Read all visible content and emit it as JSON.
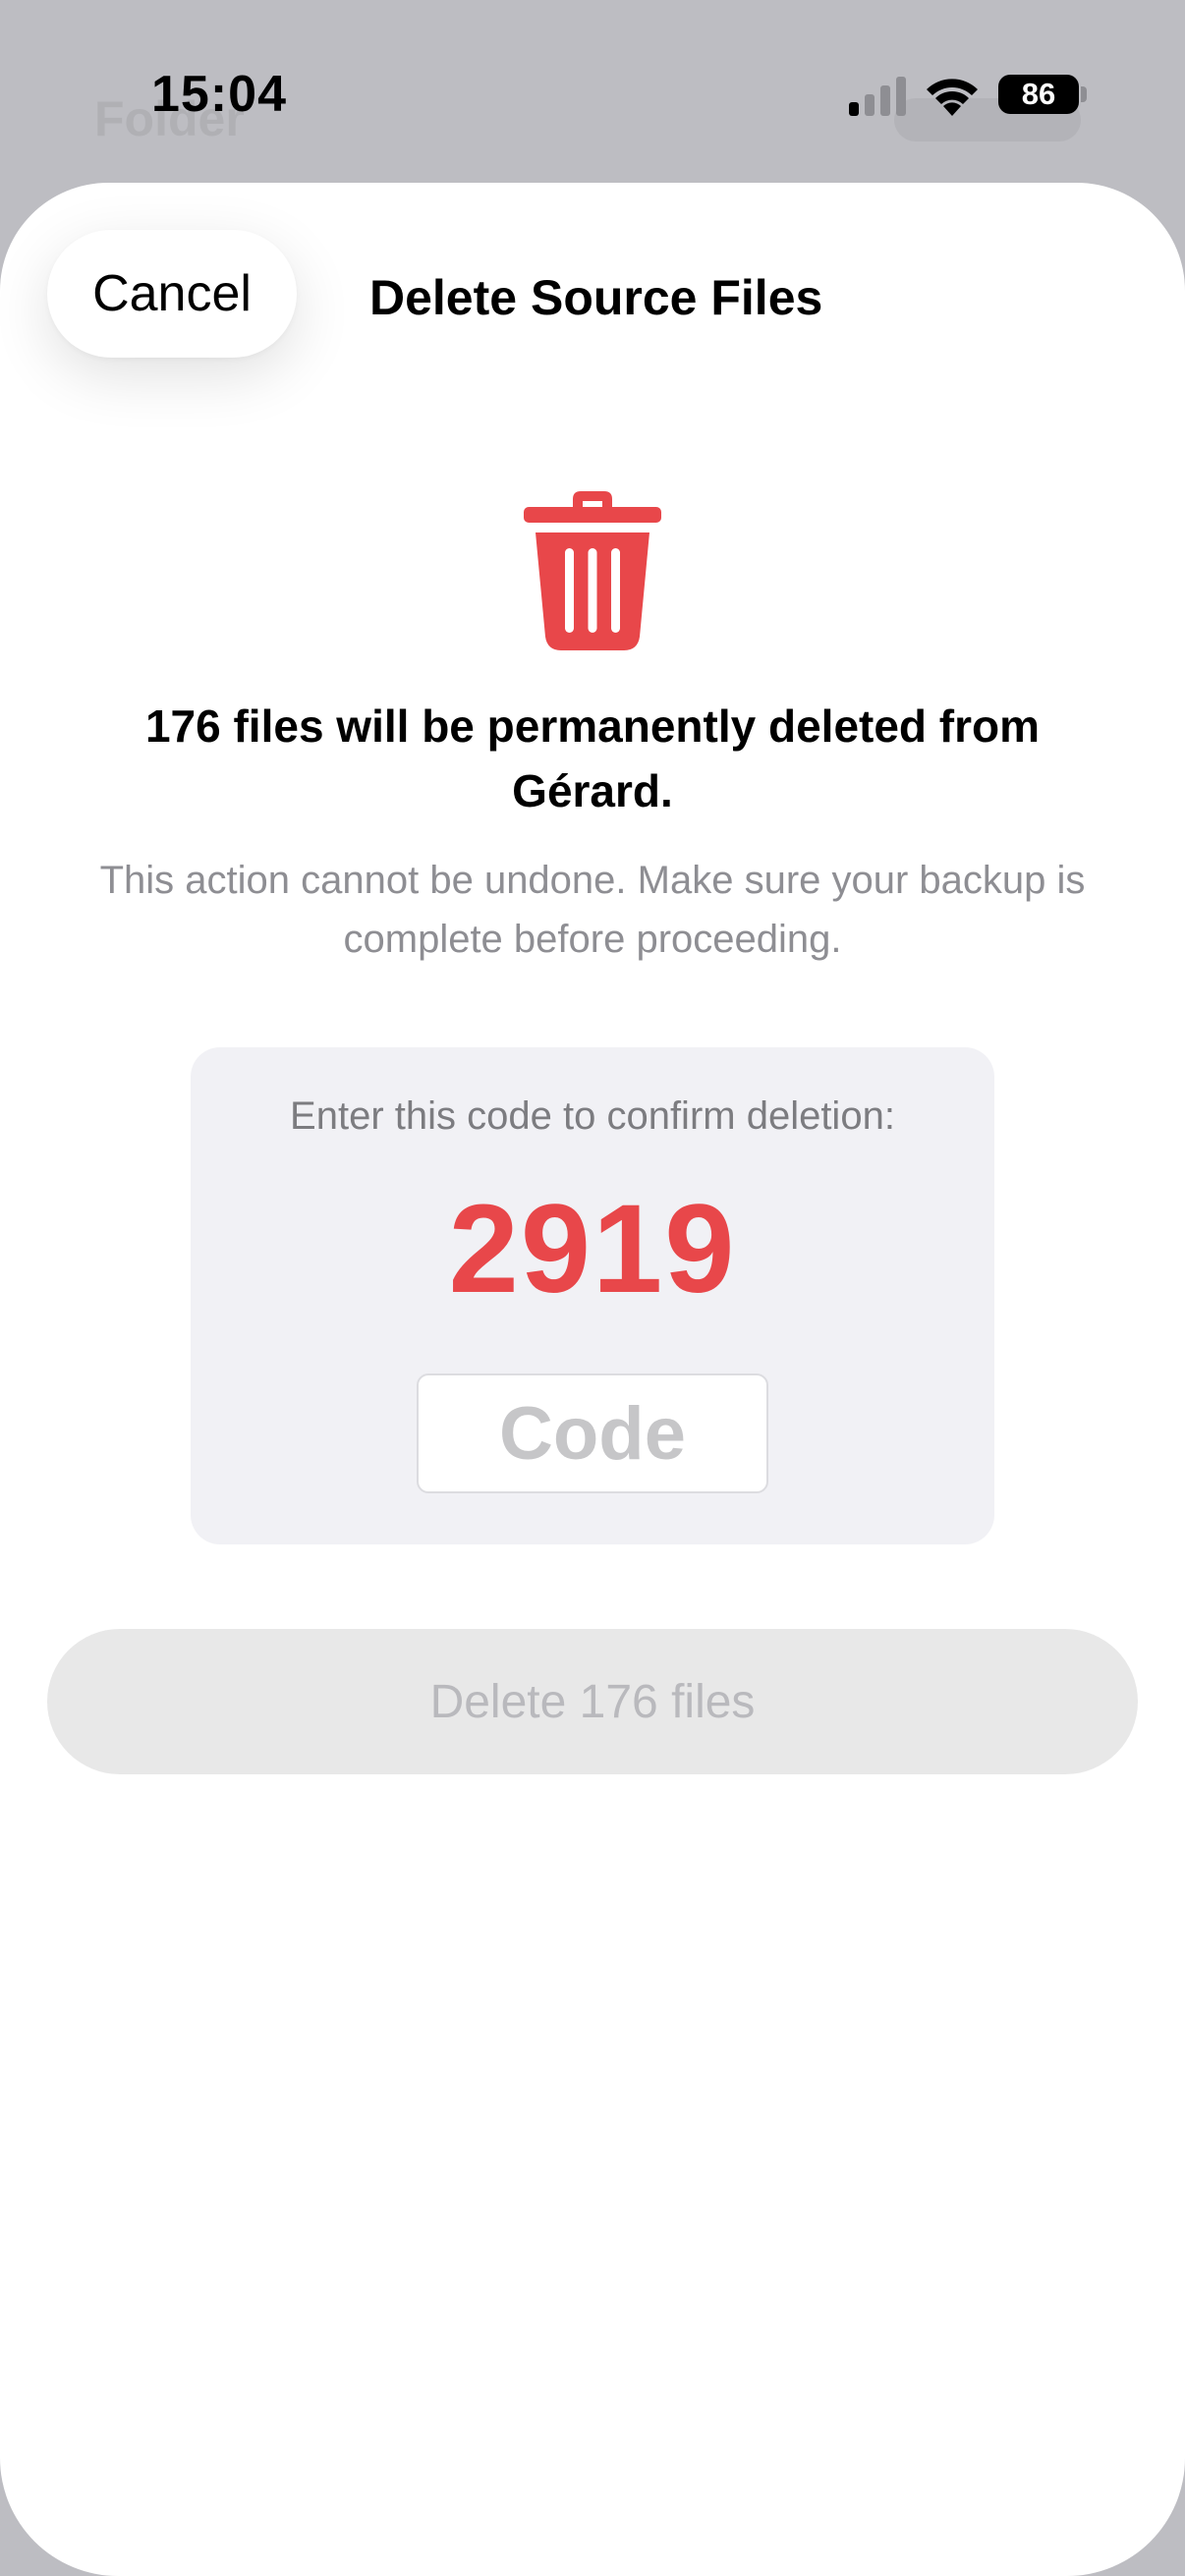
{
  "status_bar": {
    "time": "15:04",
    "battery": "86",
    "background_label": "Folder"
  },
  "sheet": {
    "cancel_label": "Cancel",
    "title": "Delete Source Files",
    "headline": "176 files will be permanently deleted from Gérard.",
    "subtext": "This action cannot be undone. Make sure your backup is complete before proceeding.",
    "confirm": {
      "instruction": "Enter this code to confirm deletion:",
      "code": "2919",
      "input_placeholder": "Code",
      "input_value": ""
    },
    "delete_button_label": "Delete 176 files",
    "delete_button_enabled": false
  },
  "colors": {
    "destructive": "#e8474a",
    "card_background": "#f1f1f5",
    "disabled_button": "#e8e8e8",
    "secondary_text": "#8e8e93"
  },
  "icons": {
    "delete": "trash-icon",
    "signal": "cellular-signal-icon",
    "wifi": "wifi-icon",
    "battery": "battery-icon"
  }
}
